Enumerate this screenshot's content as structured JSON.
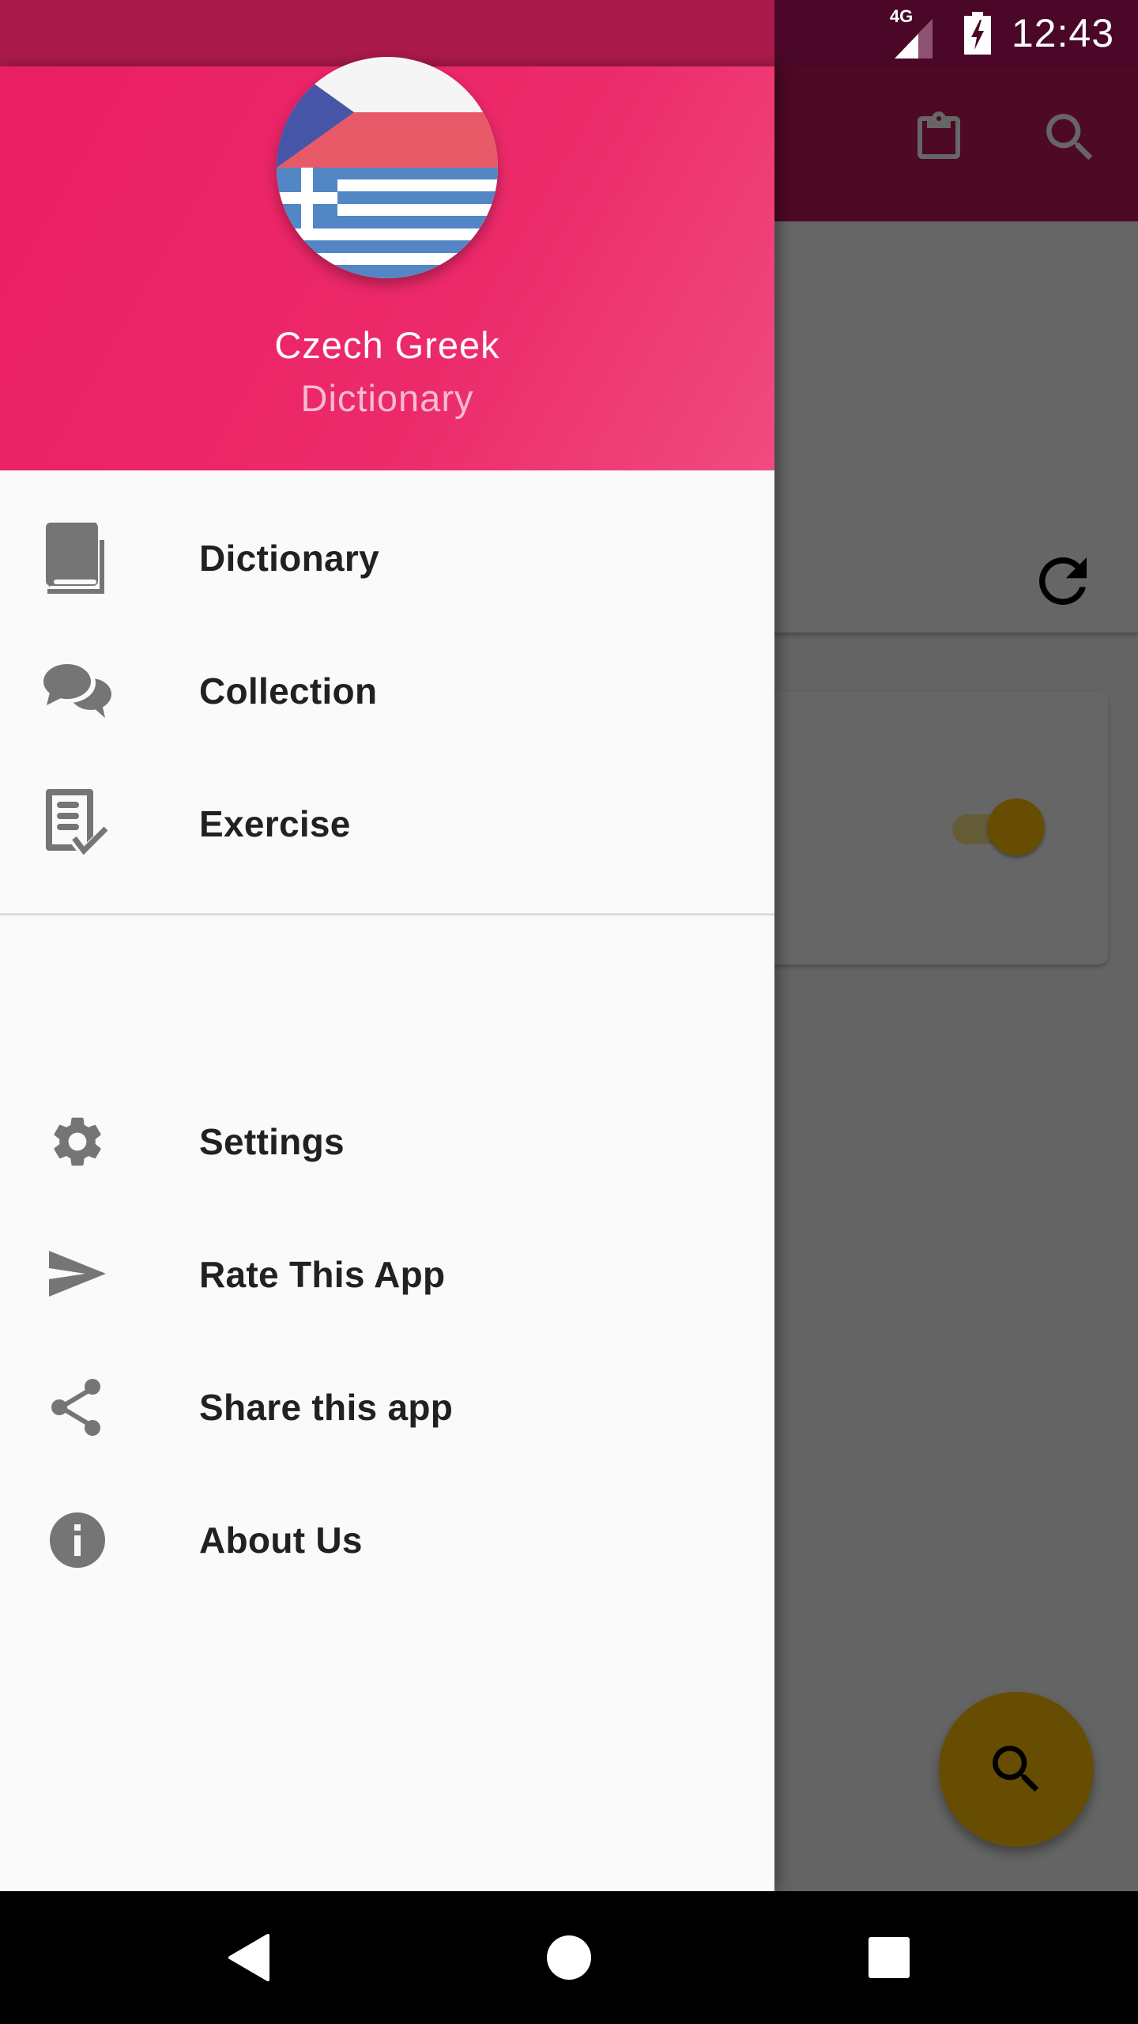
{
  "status_bar": {
    "network": "4G",
    "time": "12:43"
  },
  "drawer": {
    "header": {
      "app_name": "Czech Greek",
      "app_subtitle": "Dictionary",
      "logo": "czech-greek-flags"
    },
    "primary_items": [
      {
        "label": "Dictionary",
        "icon": "book-icon"
      },
      {
        "label": "Collection",
        "icon": "chat-bubbles-icon"
      },
      {
        "label": "Exercise",
        "icon": "checklist-icon"
      }
    ],
    "secondary_items": [
      {
        "label": "Settings",
        "icon": "gear-icon"
      },
      {
        "label": "Rate This App",
        "icon": "send-icon"
      },
      {
        "label": "Share this app",
        "icon": "share-icon"
      },
      {
        "label": "About Us",
        "icon": "info-icon"
      }
    ]
  },
  "background_app": {
    "toolbar_icons": [
      "clipboard-icon",
      "search-icon"
    ],
    "switch_on": true,
    "fab_icon": "search-icon"
  },
  "colors": {
    "primary": "#e91e63",
    "primary_dark": "#c2185b",
    "accent": "#ffc107",
    "icon_gray": "#757575"
  },
  "nav_bar": {
    "buttons": [
      "back",
      "home",
      "recents"
    ]
  }
}
